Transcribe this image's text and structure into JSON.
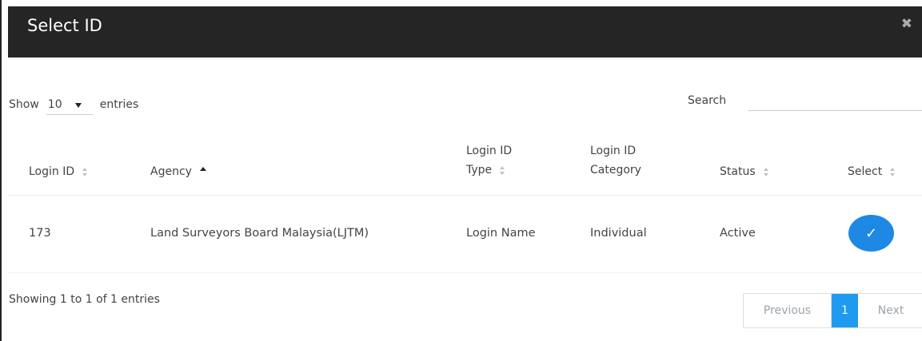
{
  "modal": {
    "title": "Select ID",
    "close_icon": "close-icon",
    "close_glyph": "✖"
  },
  "controls": {
    "show_label": "Show",
    "entries_label": "entries",
    "length_value": "10",
    "search_label": "Search",
    "search_value": ""
  },
  "table": {
    "columns": {
      "login_id": "Login ID",
      "agency": "Agency",
      "login_id_type_line1": "Login ID",
      "login_id_type_line2": "Type",
      "login_id_category_line1": "Login ID",
      "login_id_category_line2": "Category",
      "status": "Status",
      "select": "Select"
    },
    "sorted_column": "Agency",
    "rows": [
      {
        "login_id": "173",
        "agency": "Land Surveyors Board Malaysia(LJTM)",
        "login_id_type": "Login Name",
        "login_id_category": "Individual",
        "status": "Active",
        "select_glyph": "✓"
      }
    ]
  },
  "footer": {
    "info": "Showing 1 to 1 of 1 entries",
    "previous": "Previous",
    "current_page": "1",
    "next": "Next"
  },
  "colors": {
    "header_bg": "#252525",
    "accent": "#1e88e5",
    "page_active": "#1e9bf0"
  }
}
